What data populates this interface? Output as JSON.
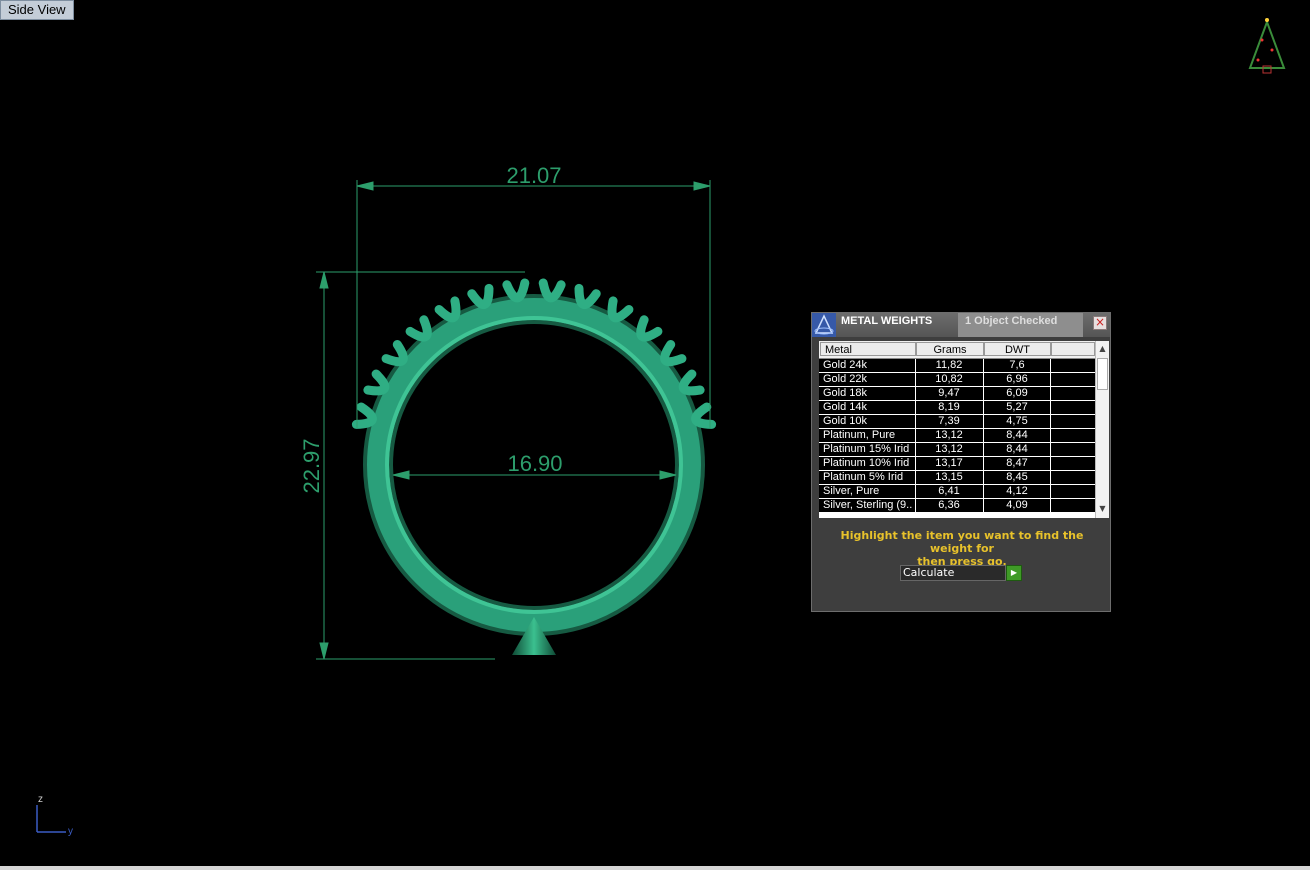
{
  "viewport": {
    "label": "Side View",
    "dimensions": {
      "width": "21.07",
      "height": "22.97",
      "inner_diameter": "16.90"
    },
    "axis": {
      "z_label": "z",
      "y_label": "y"
    }
  },
  "metal_weights_panel": {
    "title": "METAL WEIGHTS",
    "status": "1 Object Checked",
    "close_symbol": "×",
    "columns": [
      "Metal",
      "Grams",
      "DWT"
    ],
    "rows": [
      {
        "metal": "Gold 24k",
        "grams": "11,82",
        "dwt": "7,6"
      },
      {
        "metal": "Gold 22k",
        "grams": "10,82",
        "dwt": "6,96"
      },
      {
        "metal": "Gold 18k",
        "grams": "9,47",
        "dwt": "6,09"
      },
      {
        "metal": "Gold 14k",
        "grams": "8,19",
        "dwt": "5,27"
      },
      {
        "metal": "Gold 10k",
        "grams": "7,39",
        "dwt": "4,75"
      },
      {
        "metal": "Platinum, Pure",
        "grams": "13,12",
        "dwt": "8,44"
      },
      {
        "metal": "Platinum 15% Irid",
        "grams": "13,12",
        "dwt": "8,44"
      },
      {
        "metal": "Platinum 10% Irid",
        "grams": "13,17",
        "dwt": "8,47"
      },
      {
        "metal": "Platinum 5% Irid",
        "grams": "13,15",
        "dwt": "8,45"
      },
      {
        "metal": "Silver, Pure",
        "grams": "6,41",
        "dwt": "4,12"
      },
      {
        "metal": "Silver, Sterling (9...",
        "grams": "6,36",
        "dwt": "4,09"
      }
    ],
    "instructions_line1": "Highlight the item you want to find the weight for",
    "instructions_line2": "then press go.",
    "action_select_value": "Calculate"
  },
  "colors": {
    "background": "#000000",
    "ring": "#2aa07a",
    "dimension_line": "#2d9e6c",
    "panel_bg": "#3e3e3e",
    "instruction_text": "#e8c22b",
    "go_button": "#3f9a27"
  },
  "icons": {
    "tree": "christmas-tree-icon",
    "panel_logo": "app-logo-icon",
    "go": "play-arrow-icon",
    "close": "close-icon"
  }
}
